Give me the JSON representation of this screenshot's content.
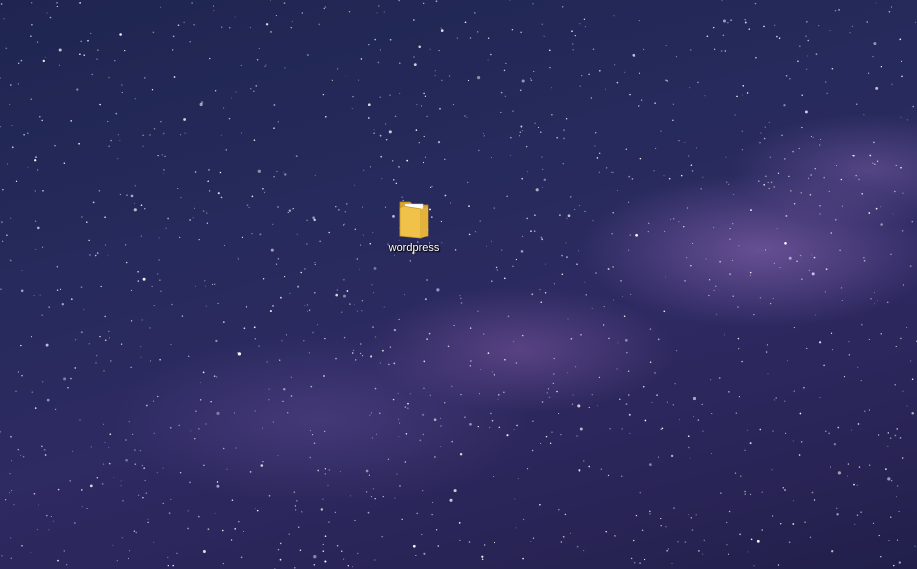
{
  "desktop": {
    "wallpaper": "starry-night-milky-way",
    "colors": {
      "sky_dark": "#1f2550",
      "nebula": "#966ebe",
      "folder_yellow": "#f1c24a",
      "label_text": "#ffffff"
    },
    "icons": [
      {
        "label": "wordpress",
        "icon": "folder-icon"
      }
    ]
  }
}
